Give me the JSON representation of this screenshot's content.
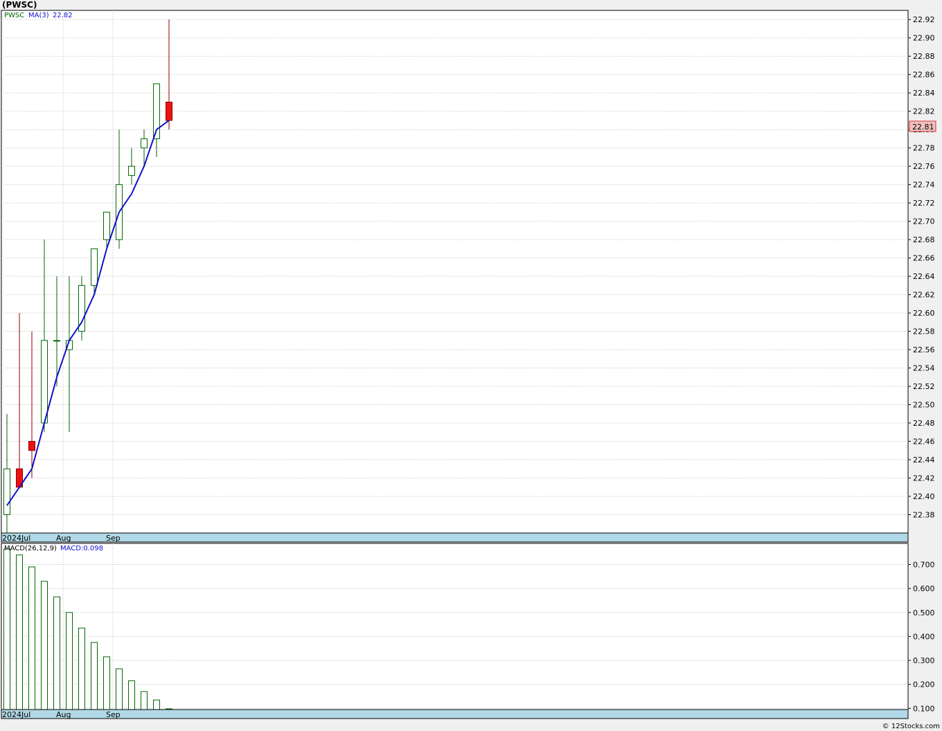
{
  "header": {
    "title": "(PWSC)"
  },
  "credit": "© 12Stocks.com",
  "colors": {
    "up_body": "#ffffff",
    "up_outline": "#006400",
    "up_wick": "#006400",
    "down_body": "#ee1111",
    "down_wick": "#8b0000",
    "ma_line": "#1010cc",
    "grid": "#bbbbbb",
    "time_bar": "#b0d8e6",
    "macd_bar": "#006400",
    "last_price_bg": "#f2c0c0"
  },
  "chart_data": [
    {
      "type": "candlestick",
      "legend": {
        "ticker": "PWSC",
        "ma_label": "MA(3)",
        "ma_value": "22.82"
      },
      "last_price_label": "22.81",
      "ylim": [
        22.36,
        22.93
      ],
      "yticks": [
        "22.38",
        "22.40",
        "22.42",
        "22.44",
        "22.46",
        "22.48",
        "22.50",
        "22.52",
        "22.54",
        "22.56",
        "22.58",
        "22.60",
        "22.62",
        "22.64",
        "22.66",
        "22.68",
        "22.70",
        "22.72",
        "22.74",
        "22.76",
        "22.78",
        "22.80",
        "22.82",
        "22.84",
        "22.86",
        "22.88",
        "22.90",
        "22.92"
      ],
      "xticks": [
        {
          "label": "2024Jul",
          "index": 0
        },
        {
          "label": "Aug",
          "index": 5
        },
        {
          "label": "Sep",
          "index": 9
        }
      ],
      "candles": [
        {
          "o": 22.38,
          "h": 22.49,
          "l": 22.36,
          "c": 22.43
        },
        {
          "o": 22.43,
          "h": 22.6,
          "l": 22.41,
          "c": 22.41
        },
        {
          "o": 22.46,
          "h": 22.58,
          "l": 22.42,
          "c": 22.45
        },
        {
          "o": 22.48,
          "h": 22.68,
          "l": 22.47,
          "c": 22.57
        },
        {
          "o": 22.57,
          "h": 22.64,
          "l": 22.52,
          "c": 22.57
        },
        {
          "o": 22.56,
          "h": 22.64,
          "l": 22.47,
          "c": 22.57
        },
        {
          "o": 22.58,
          "h": 22.64,
          "l": 22.57,
          "c": 22.63
        },
        {
          "o": 22.63,
          "h": 22.67,
          "l": 22.62,
          "c": 22.67
        },
        {
          "o": 22.68,
          "h": 22.71,
          "l": 22.67,
          "c": 22.71
        },
        {
          "o": 22.68,
          "h": 22.8,
          "l": 22.67,
          "c": 22.74
        },
        {
          "o": 22.75,
          "h": 22.78,
          "l": 22.74,
          "c": 22.76
        },
        {
          "o": 22.78,
          "h": 22.8,
          "l": 22.76,
          "c": 22.79
        },
        {
          "o": 22.79,
          "h": 22.85,
          "l": 22.77,
          "c": 22.85
        },
        {
          "o": 22.83,
          "h": 22.92,
          "l": 22.8,
          "c": 22.81
        }
      ],
      "ma": [
        22.39,
        22.41,
        22.43,
        22.48,
        22.53,
        22.57,
        22.59,
        22.62,
        22.67,
        22.71,
        22.73,
        22.76,
        22.8,
        22.81
      ]
    },
    {
      "type": "bar",
      "legend": {
        "name": "MACD(26,12,9)",
        "value_label": "MACD:0.098"
      },
      "ylim": [
        0.095,
        0.765
      ],
      "yticks": [
        "0.100",
        "0.200",
        "0.300",
        "0.400",
        "0.500",
        "0.600",
        "0.700"
      ],
      "xticks": [
        {
          "label": "2024Jul",
          "index": 0
        },
        {
          "label": "Aug",
          "index": 5
        },
        {
          "label": "Sep",
          "index": 9
        }
      ],
      "values": [
        0.765,
        0.74,
        0.69,
        0.63,
        0.565,
        0.5,
        0.435,
        0.375,
        0.315,
        0.265,
        0.215,
        0.17,
        0.135,
        0.098
      ]
    }
  ]
}
